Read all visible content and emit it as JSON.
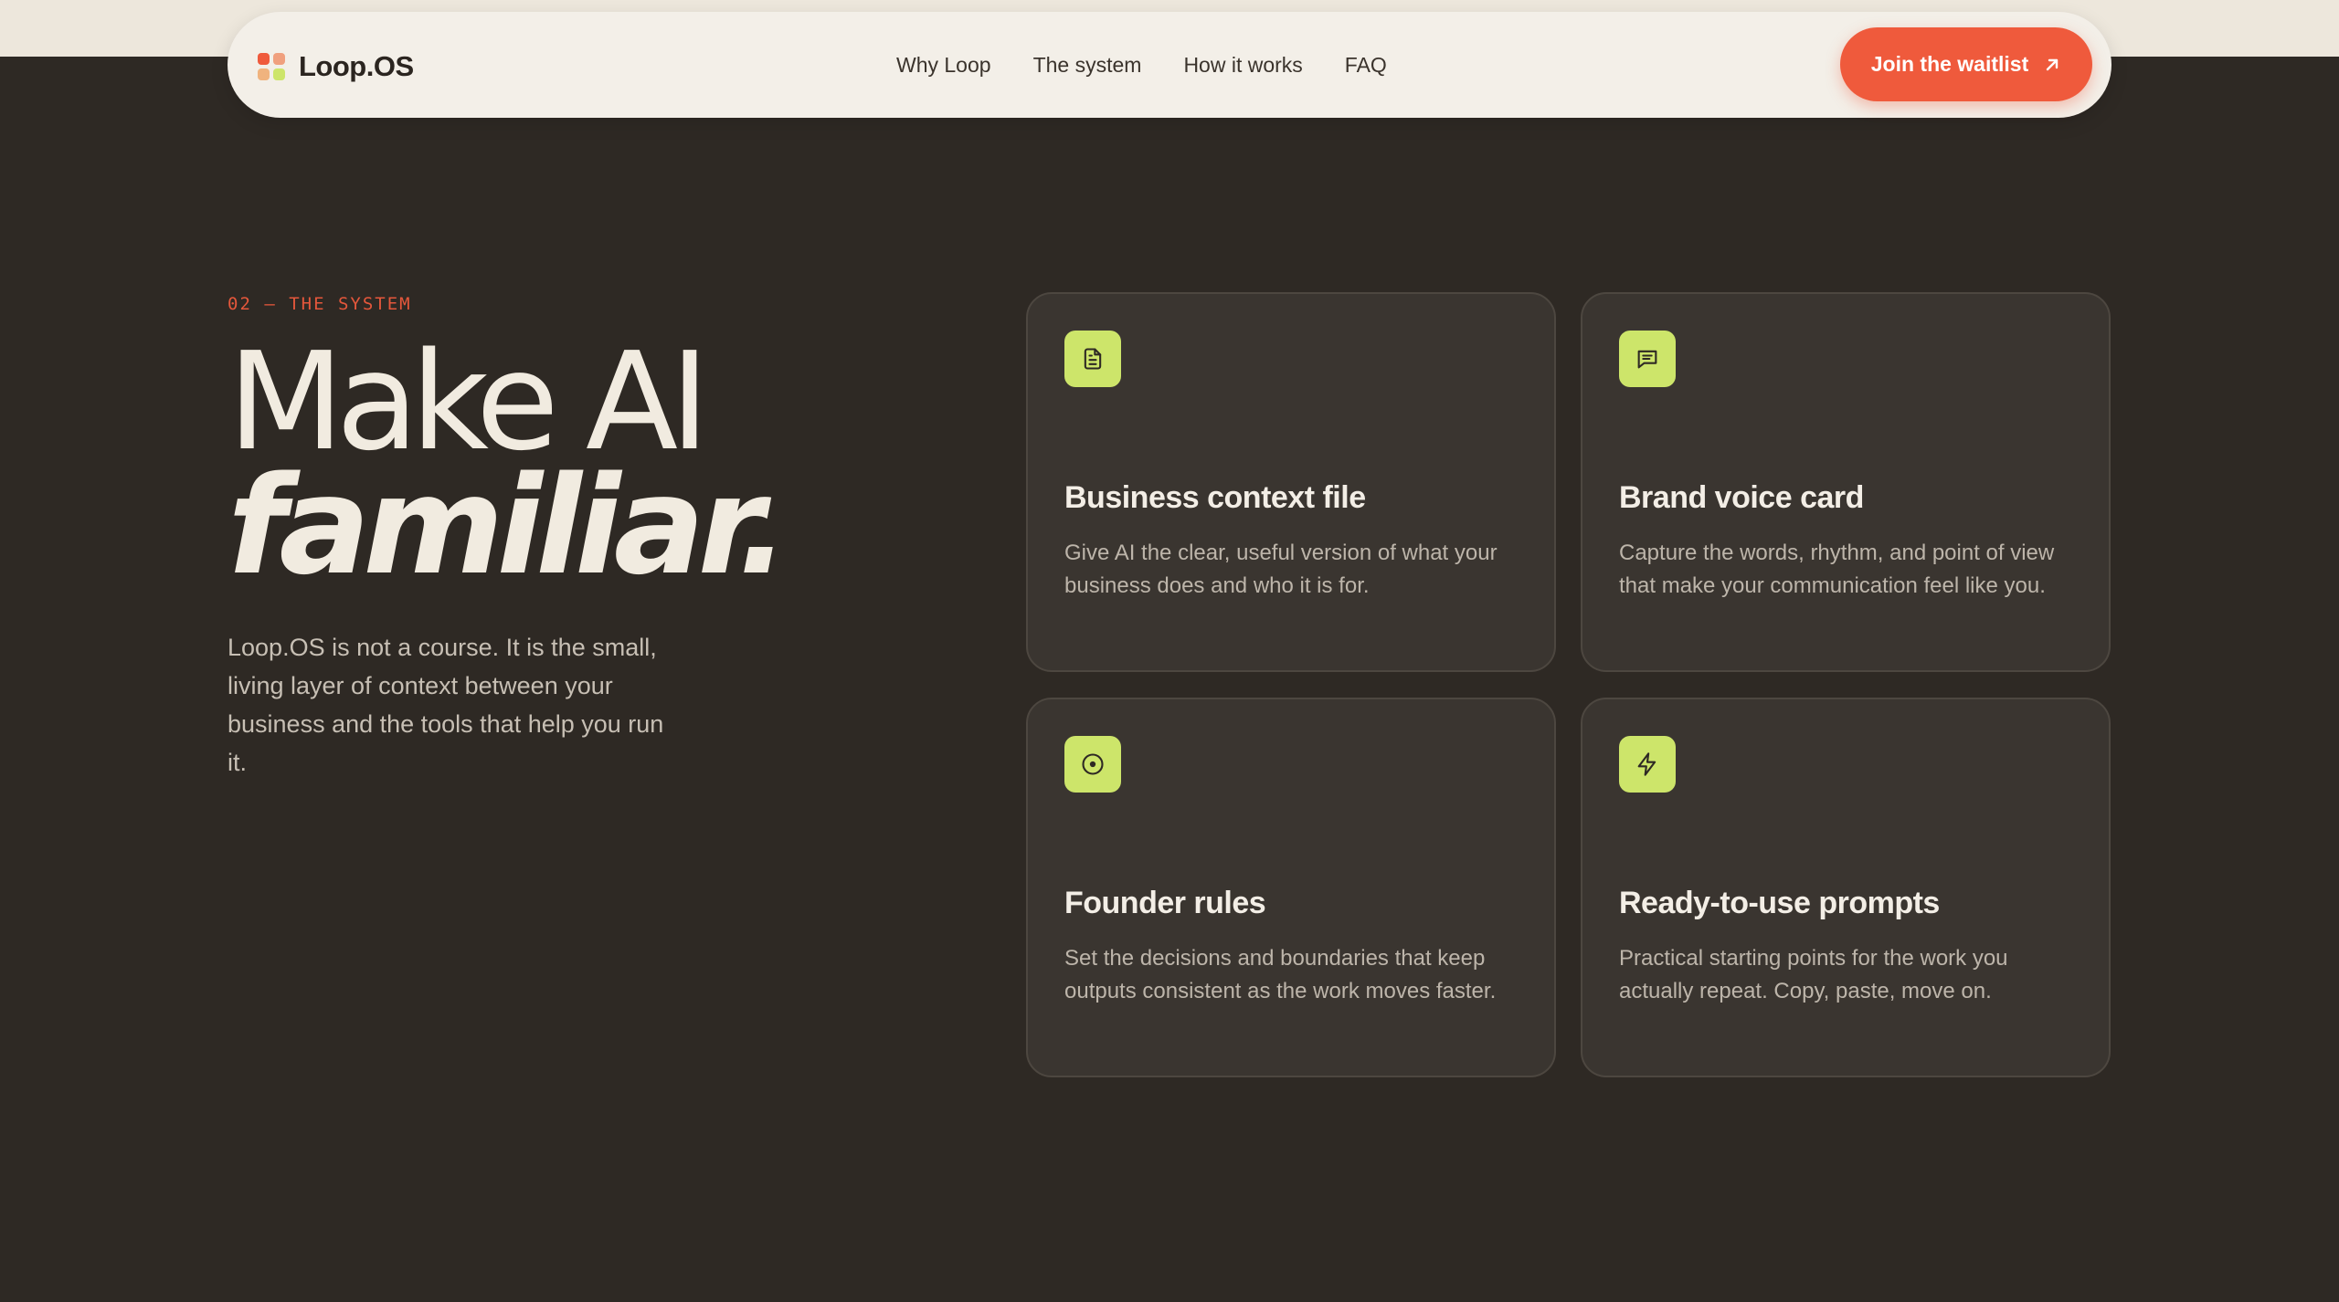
{
  "brand": {
    "name": "Loop.OS",
    "logo_colors": [
      "#ef5a3c",
      "#f09a7a",
      "#f0b37e",
      "#cde56a"
    ]
  },
  "nav": {
    "links": [
      "Why Loop",
      "The system",
      "How it works",
      "FAQ"
    ],
    "cta_label": "Join the waitlist",
    "cta_icon": "arrow-up-right-icon"
  },
  "hero": {
    "eyebrow": "02 — THE SYSTEM",
    "headline_line1": "Make AI",
    "headline_line2": "familiar.",
    "lead": "Loop.OS is not a course. It is the small, living layer of context between your business and the tools that help you run it."
  },
  "cards": [
    {
      "icon": "document-icon",
      "title": "Business context file",
      "description": "Give AI the clear, useful version of what your business does and who it is for."
    },
    {
      "icon": "message-icon",
      "title": "Brand voice card",
      "description": "Capture the words, rhythm, and point of view that make your communication feel like you."
    },
    {
      "icon": "target-icon",
      "title": "Founder rules",
      "description": "Set the decisions and boundaries that keep outputs consistent as the work moves faster."
    },
    {
      "icon": "lightning-icon",
      "title": "Ready-to-use prompts",
      "description": "Practical starting points for the work you actually repeat. Copy, paste, move on."
    }
  ],
  "colors": {
    "background": "#2e2924",
    "accent": "#ef5a3c",
    "icon_badge": "#cde56a",
    "card": "#3a3530"
  }
}
